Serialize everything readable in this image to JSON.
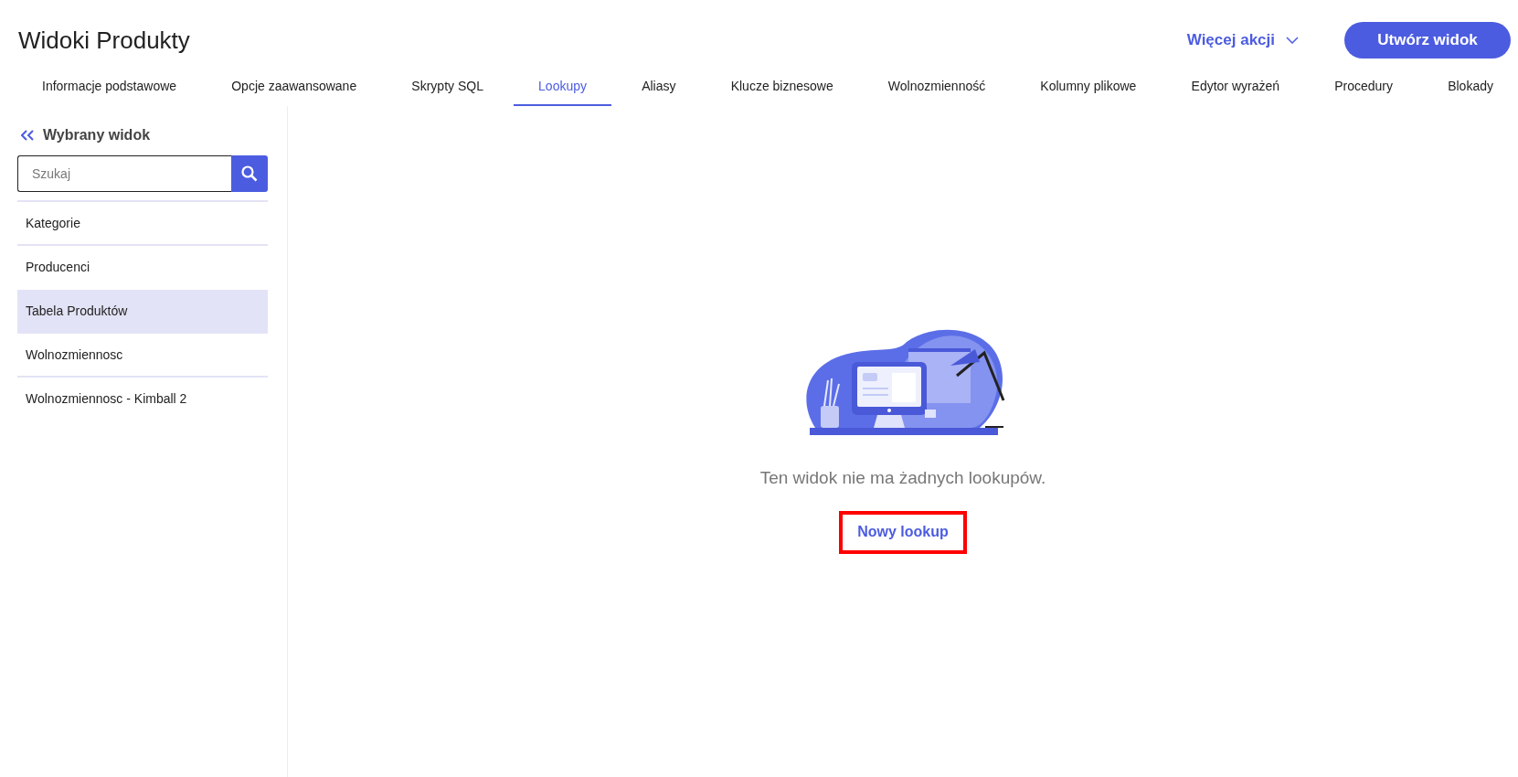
{
  "header": {
    "title": "Widoki Produkty",
    "more_actions": "Więcej akcji",
    "create_button": "Utwórz widok"
  },
  "tabs": [
    {
      "label": "Informacje podstawowe",
      "selected": false
    },
    {
      "label": "Opcje zaawansowane",
      "selected": false
    },
    {
      "label": "Skrypty SQL",
      "selected": false
    },
    {
      "label": "Lookupy",
      "selected": true
    },
    {
      "label": "Aliasy",
      "selected": false
    },
    {
      "label": "Klucze biznesowe",
      "selected": false
    },
    {
      "label": "Wolnozmienność",
      "selected": false
    },
    {
      "label": "Kolumny plikowe",
      "selected": false
    },
    {
      "label": "Edytor wyrażeń",
      "selected": false
    },
    {
      "label": "Procedury",
      "selected": false
    },
    {
      "label": "Blokady",
      "selected": false
    }
  ],
  "sidebar": {
    "title": "Wybrany widok",
    "search": {
      "placeholder": "Szukaj"
    },
    "items": [
      {
        "label": "Kategorie",
        "selected": false
      },
      {
        "label": "Producenci",
        "selected": false
      },
      {
        "label": "Tabela Produktów",
        "selected": true
      },
      {
        "label": "Wolnozmiennosc",
        "selected": false
      },
      {
        "label": "Wolnozmiennosc - Kimball 2",
        "selected": false
      }
    ]
  },
  "empty_state": {
    "message": "Ten widok nie ma żadnych lookupów.",
    "button": {
      "label": "Nowy lookup",
      "highlighted": true
    }
  }
}
